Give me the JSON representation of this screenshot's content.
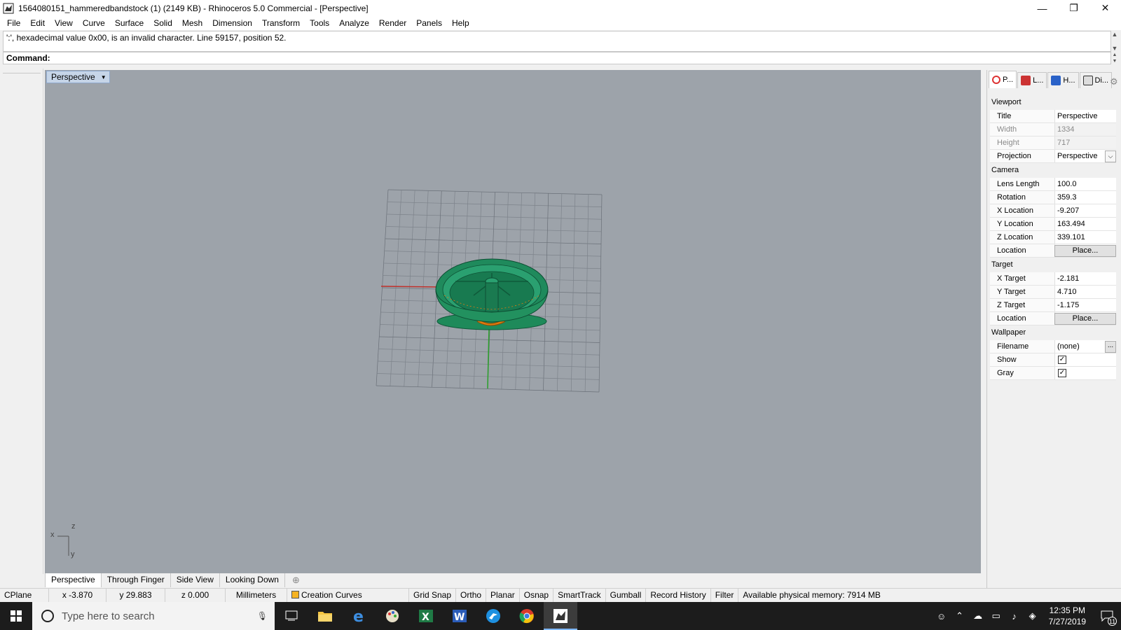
{
  "window": {
    "title": "1564080151_hammeredbandstock (1) (2149 KB) - Rhinoceros 5.0 Commercial - [Perspective]",
    "minimize": "—",
    "maximize": "❐",
    "close": "✕"
  },
  "menu": [
    "File",
    "Edit",
    "View",
    "Curve",
    "Surface",
    "Solid",
    "Mesh",
    "Dimension",
    "Transform",
    "Tools",
    "Analyze",
    "Render",
    "Panels",
    "Help"
  ],
  "command": {
    "history": "':', hexadecimal value 0x00, is an invalid character. Line 59157, position 52.",
    "prompt_label": "Command:",
    "value": ""
  },
  "viewport": {
    "title": "Perspective",
    "axis_x": "x",
    "axis_y": "y",
    "axis_z": "z"
  },
  "viewport_tabs": [
    "Perspective",
    "Through Finger",
    "Side View",
    "Looking Down"
  ],
  "panel": {
    "tabs": [
      "P...",
      "L...",
      "H...",
      "Di..."
    ],
    "sections": {
      "viewport": "Viewport",
      "camera": "Camera",
      "target": "Target",
      "wallpaper": "Wallpaper"
    },
    "viewport_rows": [
      {
        "label": "Title",
        "value": "Perspective"
      },
      {
        "label": "Width",
        "value": "1334"
      },
      {
        "label": "Height",
        "value": "717"
      },
      {
        "label": "Projection",
        "value": "Perspective"
      }
    ],
    "camera_rows": [
      {
        "label": "Lens Length",
        "value": "100.0"
      },
      {
        "label": "Rotation",
        "value": "359.3"
      },
      {
        "label": "X Location",
        "value": "-9.207"
      },
      {
        "label": "Y Location",
        "value": "163.494"
      },
      {
        "label": "Z Location",
        "value": "339.101"
      },
      {
        "label": "Location",
        "value": "Place..."
      }
    ],
    "target_rows": [
      {
        "label": "X Target",
        "value": "-2.181"
      },
      {
        "label": "Y Target",
        "value": "4.710"
      },
      {
        "label": "Z Target",
        "value": "-1.175"
      },
      {
        "label": "Location",
        "value": "Place..."
      }
    ],
    "wallpaper_rows": [
      {
        "label": "Filename",
        "value": "(none)"
      },
      {
        "label": "Show",
        "value": "✓"
      },
      {
        "label": "Gray",
        "value": "✓"
      }
    ],
    "dots": "..."
  },
  "status": {
    "cplane": "CPlane",
    "x": "x -3.870",
    "y": "y 29.883",
    "z": "z 0.000",
    "units": "Millimeters",
    "layer": "Creation Curves",
    "toggles": [
      "Grid Snap",
      "Ortho",
      "Planar",
      "Osnap",
      "SmartTrack",
      "Gumball",
      "Record History",
      "Filter"
    ],
    "memory": "Available physical memory: 7914 MB"
  },
  "taskbar": {
    "search_placeholder": "Type here to search",
    "time": "12:35 PM",
    "date": "7/27/2019",
    "notifications": "11"
  },
  "colors": {
    "viewport_bg": "#9da3aa",
    "model_green": "#1f8a5c",
    "model_orange": "#e07b10",
    "x_axis": "#c0302a",
    "y_axis": "#2aa02a"
  }
}
